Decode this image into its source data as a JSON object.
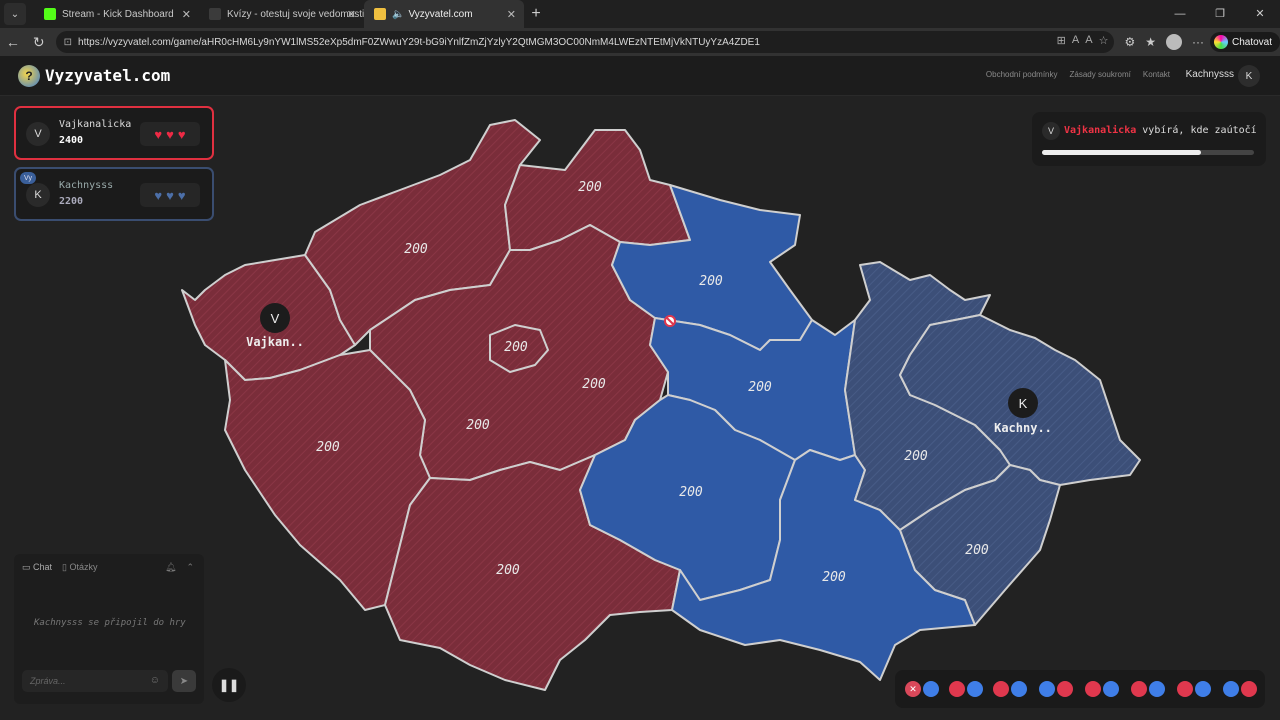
{
  "browser": {
    "tabs": [
      {
        "title": "Stream - Kick Dashboard",
        "favicon_color": "#53fc18"
      },
      {
        "title": "Kvízy - otestuj svoje vedomosti - K",
        "favicon_color": "#3b3b3b"
      },
      {
        "title": "Vyzyvatel.com",
        "favicon_color": "#f0c040"
      }
    ],
    "url": "https://vyzyvatel.com/game/aHR0cHM6Ly9nYW1lMS52eXp5dmF0ZWwuY29t-bG9iYnlfZmZjYzlyY2QtMGM3OC00NmM4LWEzNTEtMjVkNTUyYzA4ZDE1",
    "copilot_label": "Chatovat"
  },
  "site": {
    "logo": "Vyzyvatel.com",
    "nav": [
      "Obchodní podmínky",
      "Zásady soukromí",
      "Kontakt"
    ],
    "user": "Kachnysss",
    "user_initial": "K"
  },
  "players": [
    {
      "initial": "V",
      "name": "Vajkanalicka",
      "score": "2400",
      "hearts": 3,
      "color": "#e03040"
    },
    {
      "initial": "K",
      "badge": "Vy",
      "name": "Kachnysss",
      "score": "2200",
      "hearts": 3,
      "color": "#4c6fa8"
    }
  ],
  "status": {
    "initial": "V",
    "name": "Vajkanalicka",
    "text": "vybírá, kde zaútočí",
    "progress": 0.75
  },
  "map": {
    "regions": [
      {
        "value": "200",
        "owner": "red"
      },
      {
        "value": "200",
        "owner": "red"
      },
      {
        "value": "200",
        "owner": "red"
      },
      {
        "value": "200",
        "owner": "red"
      },
      {
        "value": "200",
        "owner": "red"
      },
      {
        "value": "200",
        "owner": "red"
      },
      {
        "value": "200",
        "owner": "red"
      },
      {
        "value": "200",
        "owner": "blue"
      },
      {
        "value": "200",
        "owner": "blue"
      },
      {
        "value": "200",
        "owner": "blue"
      },
      {
        "value": "200",
        "owner": "blue"
      },
      {
        "value": "200",
        "owner": "slate"
      },
      {
        "value": "200",
        "owner": "slate"
      },
      {
        "value": "200",
        "owner": "red"
      }
    ],
    "markers": [
      {
        "initial": "V",
        "label": "Vajkan.."
      },
      {
        "initial": "K",
        "label": "Kachny.."
      }
    ],
    "colors": {
      "red": "#7a2d3a",
      "blue": "#2f5aa6",
      "slate": "#3c4f78"
    }
  },
  "chat": {
    "tabs": [
      "Chat",
      "Otázky"
    ],
    "message": "Kachnysss se připojil do hry",
    "input_placeholder": "Zpráva..."
  },
  "rounds": [
    "x",
    "b",
    "r",
    "b",
    "r",
    "b",
    "b",
    "r",
    "r",
    "b",
    "r",
    "b",
    "r",
    "b",
    "b",
    "r"
  ]
}
